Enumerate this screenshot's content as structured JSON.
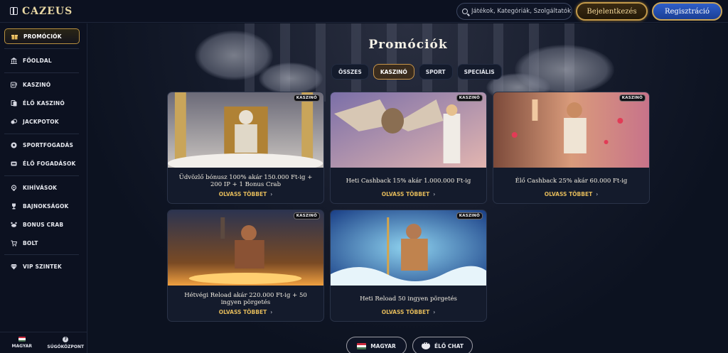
{
  "header": {
    "logo": "CAZEUS",
    "search_placeholder": "Játékok, Kategóriák, Szolgáltatók",
    "login_label": "Bejelentkezés",
    "register_label": "Regisztráció"
  },
  "sidebar": {
    "items": [
      {
        "label": "PROMÓCIÓK",
        "icon": "gift-icon",
        "active": true
      },
      {
        "label": "FŐOLDAL",
        "icon": "building-icon"
      },
      {
        "label": "KASZINÓ",
        "icon": "slot-icon"
      },
      {
        "label": "ÉLŐ KASZINÓ",
        "icon": "cards-icon"
      },
      {
        "label": "JACKPOTOK",
        "icon": "jackpot-icon"
      },
      {
        "label": "SPORTFOGADÁS",
        "icon": "ball-icon"
      },
      {
        "label": "ÉLŐ FOGADÁSOK",
        "icon": "live-icon"
      },
      {
        "label": "KIHÍVÁSOK",
        "icon": "medal-icon"
      },
      {
        "label": "BAJNOKSÁGOK",
        "icon": "trophy-icon"
      },
      {
        "label": "BONUS CRAB",
        "icon": "crab-icon"
      },
      {
        "label": "BOLT",
        "icon": "cart-icon"
      },
      {
        "label": "VIP SZINTEK",
        "icon": "diamond-icon"
      }
    ],
    "language_label": "MAGYAR",
    "help_label": "SÚGÓKÖZPONT"
  },
  "main": {
    "title": "Promóciók",
    "tabs": [
      {
        "label": "ÖSSZES",
        "active": false
      },
      {
        "label": "KASZINÓ",
        "active": true
      },
      {
        "label": "SPORT",
        "active": false
      },
      {
        "label": "SPECIÁLIS",
        "active": false
      }
    ],
    "badge": "KASZINÓ",
    "read_more": "OLVASS TÖBBET",
    "promos": [
      {
        "title": "Üdvözlő bónusz 100% akár 150.000 Ft-ig + 200 IP + 1 Bonus Crab",
        "badge": "KASZINÓ"
      },
      {
        "title": "Heti Cashback 15% akár 1.000.000 Ft-ig",
        "badge": "KASZINÓ"
      },
      {
        "title": "Élő Cashback 25% akár 60.000 Ft-ig",
        "badge": "KASZINÓ"
      },
      {
        "title": "Hétvégi Reload akár 220.000 Ft-ig + 50 ingyen pörgetés",
        "badge": "KASZINÓ"
      },
      {
        "title": "Heti Reload 50 ingyen pörgetés",
        "badge": "KASZINÓ"
      }
    ],
    "language_button": "MAGYAR",
    "chat_button": "ÉLŐ CHAT"
  },
  "colors": {
    "gold_accent": "#c39a4a",
    "blue_register": "#2e5ec9",
    "read_more": "#e2b95a",
    "background": "#0d1322"
  }
}
